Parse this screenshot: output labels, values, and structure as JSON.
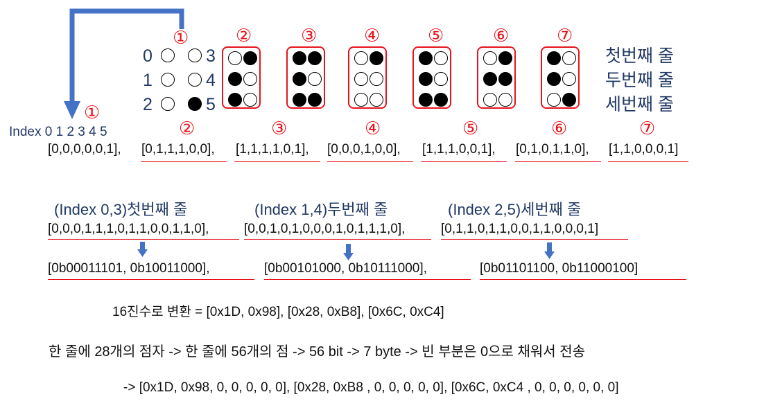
{
  "colors": {
    "navy": "#203864",
    "red": "#e8121a",
    "arrow_blue": "#4472c4",
    "text": "#111111"
  },
  "circled": [
    "①",
    "②",
    "③",
    "④",
    "⑤",
    "⑥",
    "⑦"
  ],
  "index_labels": {
    "left": [
      "0",
      "1",
      "2"
    ],
    "right": [
      "3",
      "4",
      "5"
    ]
  },
  "row_labels": [
    "첫번째 줄",
    "두번째 줄",
    "세번째 줄"
  ],
  "index_line": "Index 0 1 2 3 4 5",
  "braille_cells": [
    {
      "label": "①",
      "dots": [
        0,
        0,
        0,
        0,
        0,
        1
      ],
      "array_text": "[0,0,0,0,0,1],"
    },
    {
      "label": "②",
      "dots": [
        0,
        1,
        1,
        1,
        0,
        0
      ],
      "array_text": "[0,1,1,1,0,0],"
    },
    {
      "label": "③",
      "dots": [
        1,
        1,
        1,
        1,
        0,
        1
      ],
      "array_text": "[1,1,1,1,0,1],"
    },
    {
      "label": "④",
      "dots": [
        0,
        0,
        0,
        1,
        0,
        0
      ],
      "array_text": "[0,0,0,1,0,0],"
    },
    {
      "label": "⑤",
      "dots": [
        1,
        1,
        1,
        0,
        0,
        1
      ],
      "array_text": "[1,1,1,0,0,1],"
    },
    {
      "label": "⑥",
      "dots": [
        0,
        1,
        0,
        1,
        1,
        0
      ],
      "array_text": "[0,1,0,1,1,0],"
    },
    {
      "label": "⑦",
      "dots": [
        1,
        1,
        0,
        0,
        0,
        1
      ],
      "array_text": "[1,1,0,0,0,1]"
    }
  ],
  "row_headers": [
    "(Index 0,3)첫번째 줄",
    "(Index 1,4)두번째 줄",
    "(Index 2,5)세번째 줄"
  ],
  "row_arrays": [
    "[0,0,0,1,1,1,0,1,1,0,0,1,1,0],",
    "[0,0,1,0,1,0,0,0,1,0,1,1,1,0],",
    "[0,1,1,0,1,1,0,0,1,1,0,0,0,1]"
  ],
  "binary_arrays": [
    "[0b00011101, 0b10011000],",
    "[0b00101000, 0b10111000],",
    "[0b01101100, 0b11000100]"
  ],
  "hex_line": "16진수로 변환 = [0x1D, 0x98], [0x28, 0xB8], [0x6C, 0xC4]",
  "explain_line": "한 줄에 28개의 점자 -> 한 줄에 56개의 점 -> 56 bit -> 7 byte -> 빈 부분은 0으로 채워서 전송",
  "final_line": "-> [0x1D, 0x98, 0, 0, 0, 0, 0], [0x28, 0xB8 , 0, 0, 0, 0, 0], [0x6C, 0xC4 , 0, 0, 0, 0, 0, 0]"
}
